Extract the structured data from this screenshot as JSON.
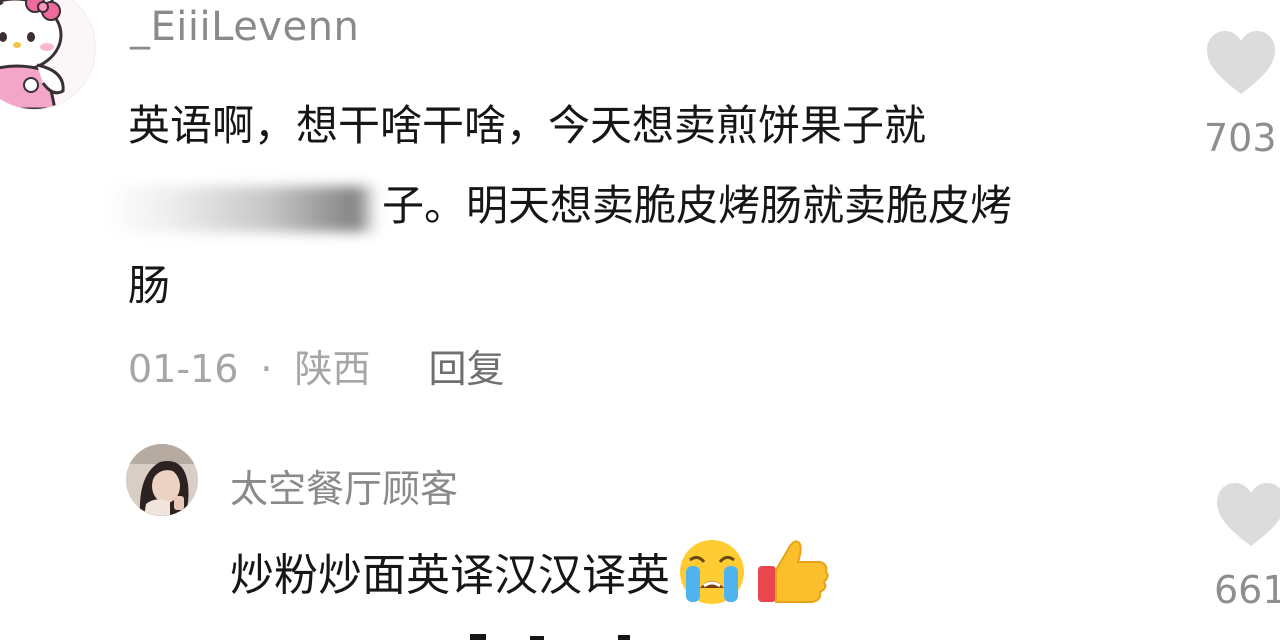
{
  "comment": {
    "username": "_EiiiLevenn",
    "lines": [
      "英语啊，想干啥干啥，今天想卖煎饼果子就",
      "子。明天想卖脆皮烤肠就卖脆皮烤",
      "肠"
    ],
    "date": "01-16",
    "separator": "·",
    "location": "陕西",
    "reply_label": "回复",
    "likes": "703"
  },
  "reply": {
    "username": "太空餐厅顾客",
    "text": "炒粉炒面英译汉汉译英",
    "likes": "661"
  },
  "icons": {
    "heart": "heart-icon",
    "crying": "loudly-crying-face-emoji",
    "thumbs": "thumbs-up-emoji"
  },
  "colors": {
    "text": "#161616",
    "username": "#8a8a8a",
    "meta": "#a6a6a6",
    "heart": "#dcdcdc"
  }
}
